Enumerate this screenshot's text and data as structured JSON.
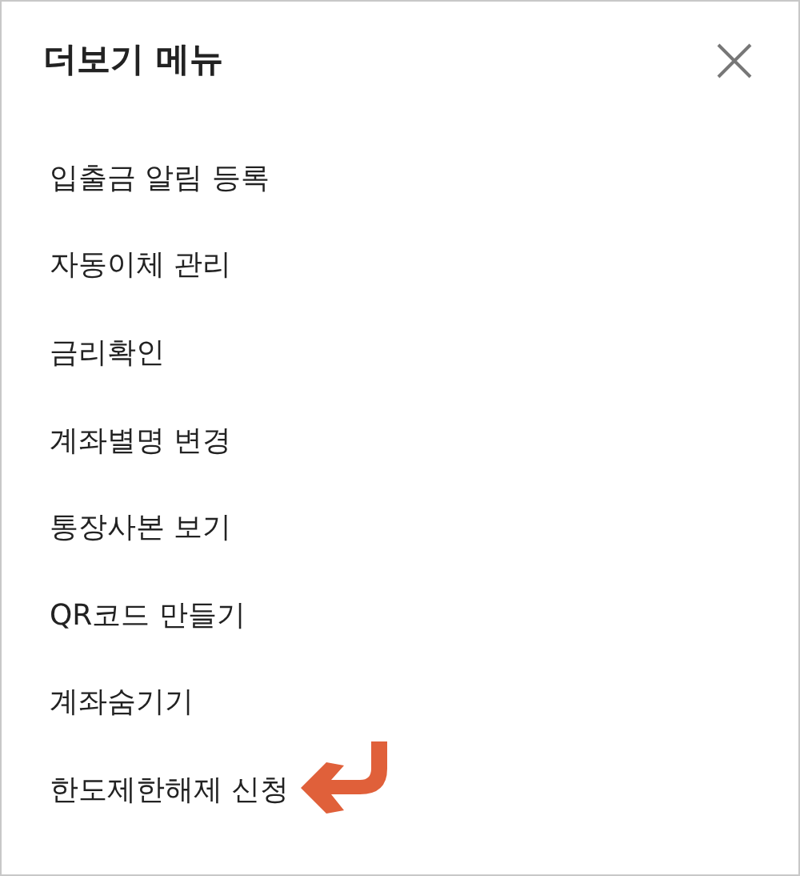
{
  "header": {
    "title": "더보기 메뉴"
  },
  "menu_items": [
    {
      "label": "입출금 알림 등록",
      "highlighted": false
    },
    {
      "label": "자동이체 관리",
      "highlighted": false
    },
    {
      "label": "금리확인",
      "highlighted": false
    },
    {
      "label": "계좌별명 변경",
      "highlighted": false
    },
    {
      "label": "통장사본 보기",
      "highlighted": false
    },
    {
      "label": "QR코드 만들기",
      "highlighted": false
    },
    {
      "label": "계좌숨기기",
      "highlighted": false
    },
    {
      "label": "한도제한해제 신청",
      "highlighted": true
    }
  ]
}
